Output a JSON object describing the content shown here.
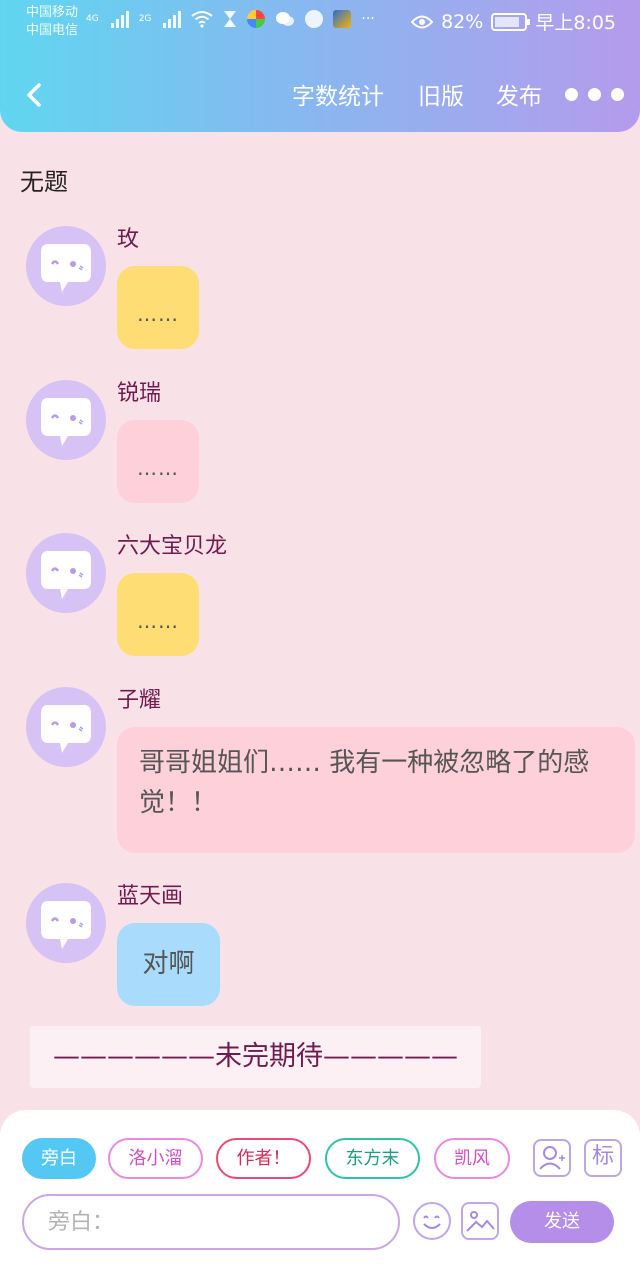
{
  "status_bar": {
    "carrier1": "中国移动",
    "carrier2": "中国电信",
    "net1": "4G",
    "net2": "2G",
    "battery": "82%",
    "time": "早上8:05"
  },
  "header": {
    "back_icon": "chevron-left-icon",
    "word_count": "字数统计",
    "old_version": "旧版",
    "publish": "发布",
    "more_icon": "more-dots-icon"
  },
  "story": {
    "title": "无题",
    "messages": [
      {
        "sender": "玫",
        "text": "……",
        "color": "#fddd74"
      },
      {
        "sender": "锐瑞",
        "text": "……",
        "color": "#fed0da"
      },
      {
        "sender": "六大宝贝龙",
        "text": "……",
        "color": "#fddd74"
      },
      {
        "sender": "子耀",
        "text": "哥哥姐姐们…… 我有一种被忽略了的感觉！！",
        "color": "#fed0da"
      },
      {
        "sender": "蓝天画",
        "text": "对啊",
        "color": "#a9dcfc"
      }
    ],
    "ending": "——————未完期待—————"
  },
  "composer": {
    "roles": [
      "旁白",
      "洛小溜",
      "作者！",
      "东方末",
      "凯风"
    ],
    "selected_role": "旁白",
    "mark_label": "标",
    "input_placeholder": "旁白：",
    "send_label": "发送"
  },
  "colors": {
    "header_start": "#5fd6f0",
    "header_end": "#b59bec",
    "background": "#f9e1e8",
    "sender_name": "#6f1b4f",
    "send_button": "#b48ee9"
  }
}
